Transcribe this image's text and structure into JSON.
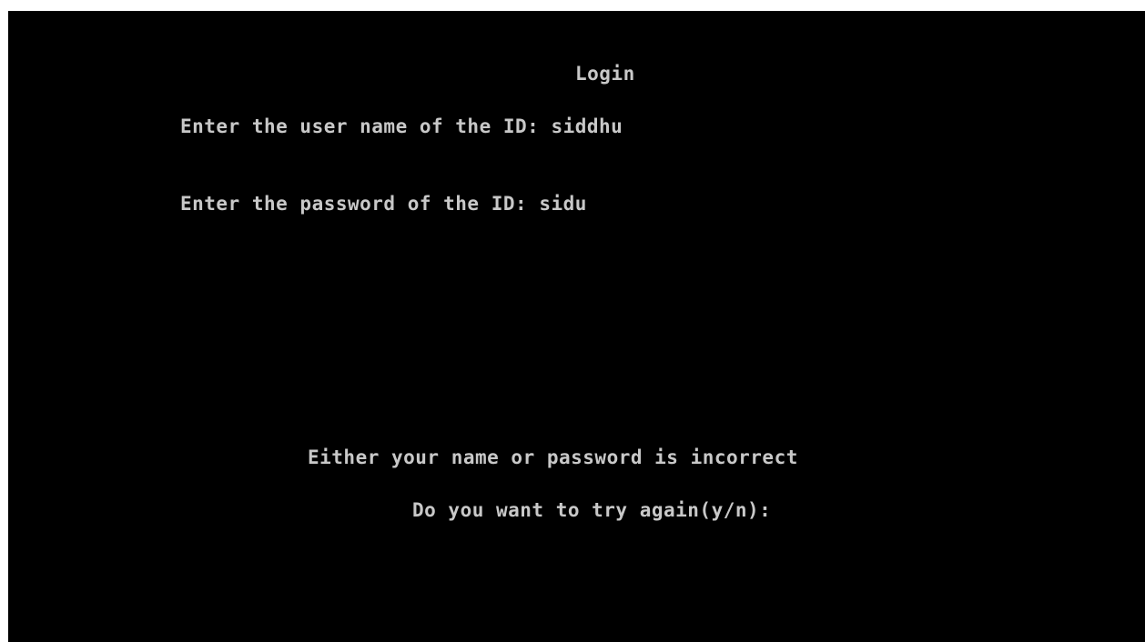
{
  "console": {
    "title": "Login",
    "username_prompt": "Enter the user name of the ID:",
    "username_value": "siddhu",
    "password_prompt": "Enter the password of the ID:",
    "password_value": "sidu",
    "error_message": "Either your name or password is incorrect",
    "retry_prompt": "Do you want to try again(y/n):"
  },
  "colors": {
    "background": "#000000",
    "text": "#c8c8c8"
  }
}
